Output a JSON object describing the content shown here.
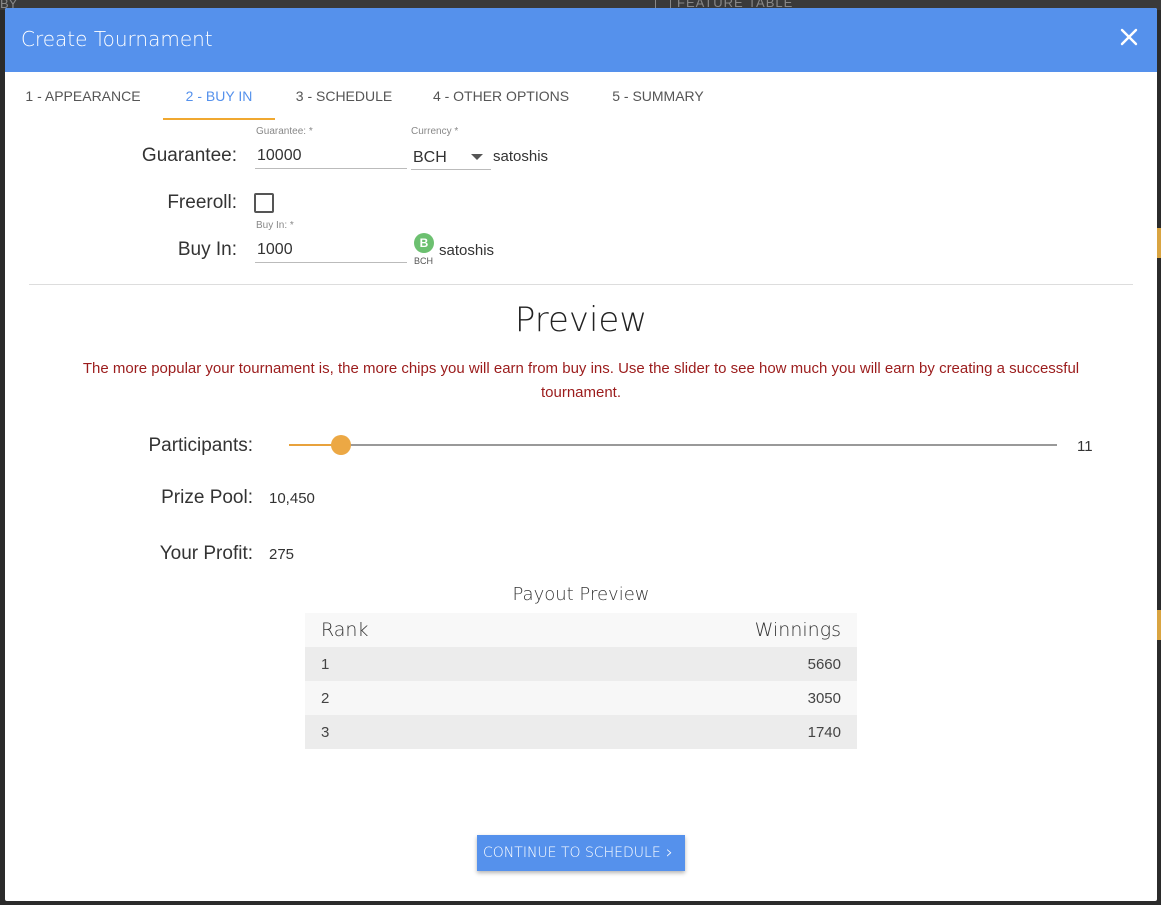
{
  "background": {
    "left_text": "BY",
    "right_text": "FEATURE TABLE"
  },
  "header": {
    "title": "Create Tournament",
    "color": "#5591ec"
  },
  "tabs": [
    {
      "label": "1 - APPEARANCE",
      "active": false
    },
    {
      "label": "2 - BUY IN",
      "active": true
    },
    {
      "label": "3 - SCHEDULE",
      "active": false
    },
    {
      "label": "4 - OTHER OPTIONS",
      "active": false
    },
    {
      "label": "5 - SUMMARY",
      "active": false
    }
  ],
  "form": {
    "guarantee": {
      "label": "Guarantee:",
      "field_label": "Guarantee: *",
      "value": "10000",
      "currency_label": "Currency *",
      "currency_value": "BCH",
      "unit": "satoshis"
    },
    "freeroll": {
      "label": "Freeroll:",
      "checked": false
    },
    "buy_in": {
      "label": "Buy In:",
      "field_label": "Buy In: *",
      "value": "1000",
      "coin_symbol": "B",
      "coin_label": "BCH",
      "unit": "satoshis"
    }
  },
  "preview": {
    "title": "Preview",
    "warning": "The more popular your tournament is, the more chips you will earn from buy ins. Use the slider to see how much you will earn by creating a successful tournament.",
    "participants_label": "Participants:",
    "participants_value": "11",
    "slider_fraction": 0.037,
    "prize_pool_label": "Prize Pool:",
    "prize_pool_value": "10,450",
    "profit_label": "Your Profit:",
    "profit_value": "275"
  },
  "payout": {
    "title": "Payout Preview",
    "headers": [
      "Rank",
      "Winnings"
    ],
    "rows": [
      [
        "1",
        "5660"
      ],
      [
        "2",
        "3050"
      ],
      [
        "3",
        "1740"
      ]
    ]
  },
  "continue_label": "CONTINUE TO SCHEDULE"
}
